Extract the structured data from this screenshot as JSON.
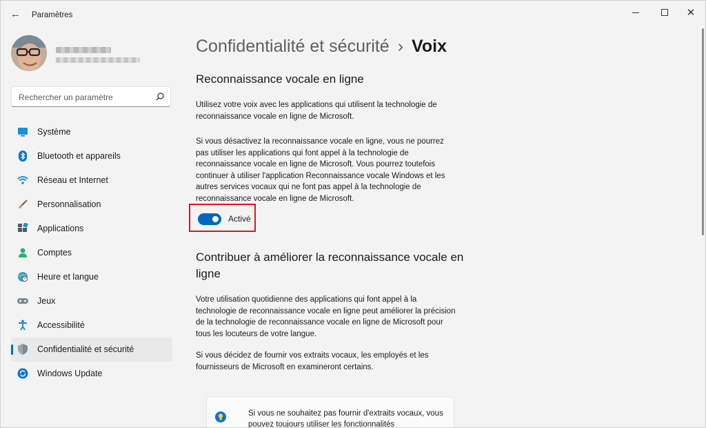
{
  "window": {
    "title": "Paramètres",
    "back_icon": "arrow-left-icon",
    "controls": [
      "minimize-icon",
      "maximize-icon",
      "close-icon"
    ]
  },
  "search": {
    "placeholder": "Rechercher un paramètre",
    "icon": "search-icon"
  },
  "sidebar": {
    "items": [
      {
        "label": "Système",
        "icon": "monitor-icon",
        "active": false
      },
      {
        "label": "Bluetooth et appareils",
        "icon": "bluetooth-icon",
        "active": false
      },
      {
        "label": "Réseau et Internet",
        "icon": "wifi-icon",
        "active": false
      },
      {
        "label": "Personnalisation",
        "icon": "brush-icon",
        "active": false
      },
      {
        "label": "Applications",
        "icon": "apps-icon",
        "active": false
      },
      {
        "label": "Comptes",
        "icon": "person-icon",
        "active": false
      },
      {
        "label": "Heure et langue",
        "icon": "globe-clock-icon",
        "active": false
      },
      {
        "label": "Jeux",
        "icon": "gamepad-icon",
        "active": false
      },
      {
        "label": "Accessibilité",
        "icon": "accessibility-icon",
        "active": false
      },
      {
        "label": "Confidentialité et sécurité",
        "icon": "shield-icon",
        "active": true
      },
      {
        "label": "Windows Update",
        "icon": "update-icon",
        "active": false
      }
    ]
  },
  "breadcrumb": {
    "parent": "Confidentialité et sécurité",
    "separator": "›",
    "current": "Voix"
  },
  "section1": {
    "title": "Reconnaissance vocale en ligne",
    "para1": "Utilisez votre voix avec les applications qui utilisent la technologie de reconnaissance vocale en ligne de Microsoft.",
    "para2": "Si vous désactivez la reconnaissance vocale en ligne, vous ne pourrez pas utiliser les applications qui font appel à la technologie de reconnaissance vocale en ligne de Microsoft. Vous pourrez toutefois continuer à utiliser l'application Reconnaissance vocale Windows et les autres services vocaux qui ne font pas appel à la technologie de reconnaissance vocale en ligne de Microsoft.",
    "toggle_label": "Activé",
    "toggle_on": true
  },
  "section2": {
    "title": "Contribuer à améliorer la reconnaissance vocale en ligne",
    "para1": "Votre utilisation quotidienne des applications qui font appel à la technologie de reconnaissance vocale en ligne peut améliorer la précision de la technologie de reconnaissance vocale en ligne de Microsoft pour tous les locuteurs de votre langue.",
    "para2": "Si vous décidez de fournir vos extraits vocaux, les employés et les fournisseurs de Microsoft en examineront certains.",
    "card_text": "Si vous ne souhaitez pas fournir d'extraits vocaux, vous pouvez toujours utiliser les fonctionnalités",
    "card_icon": "lightbulb-icon"
  },
  "colors": {
    "accent": "#0067c0",
    "highlight": "#e0121d",
    "background": "#f3f3f3"
  }
}
